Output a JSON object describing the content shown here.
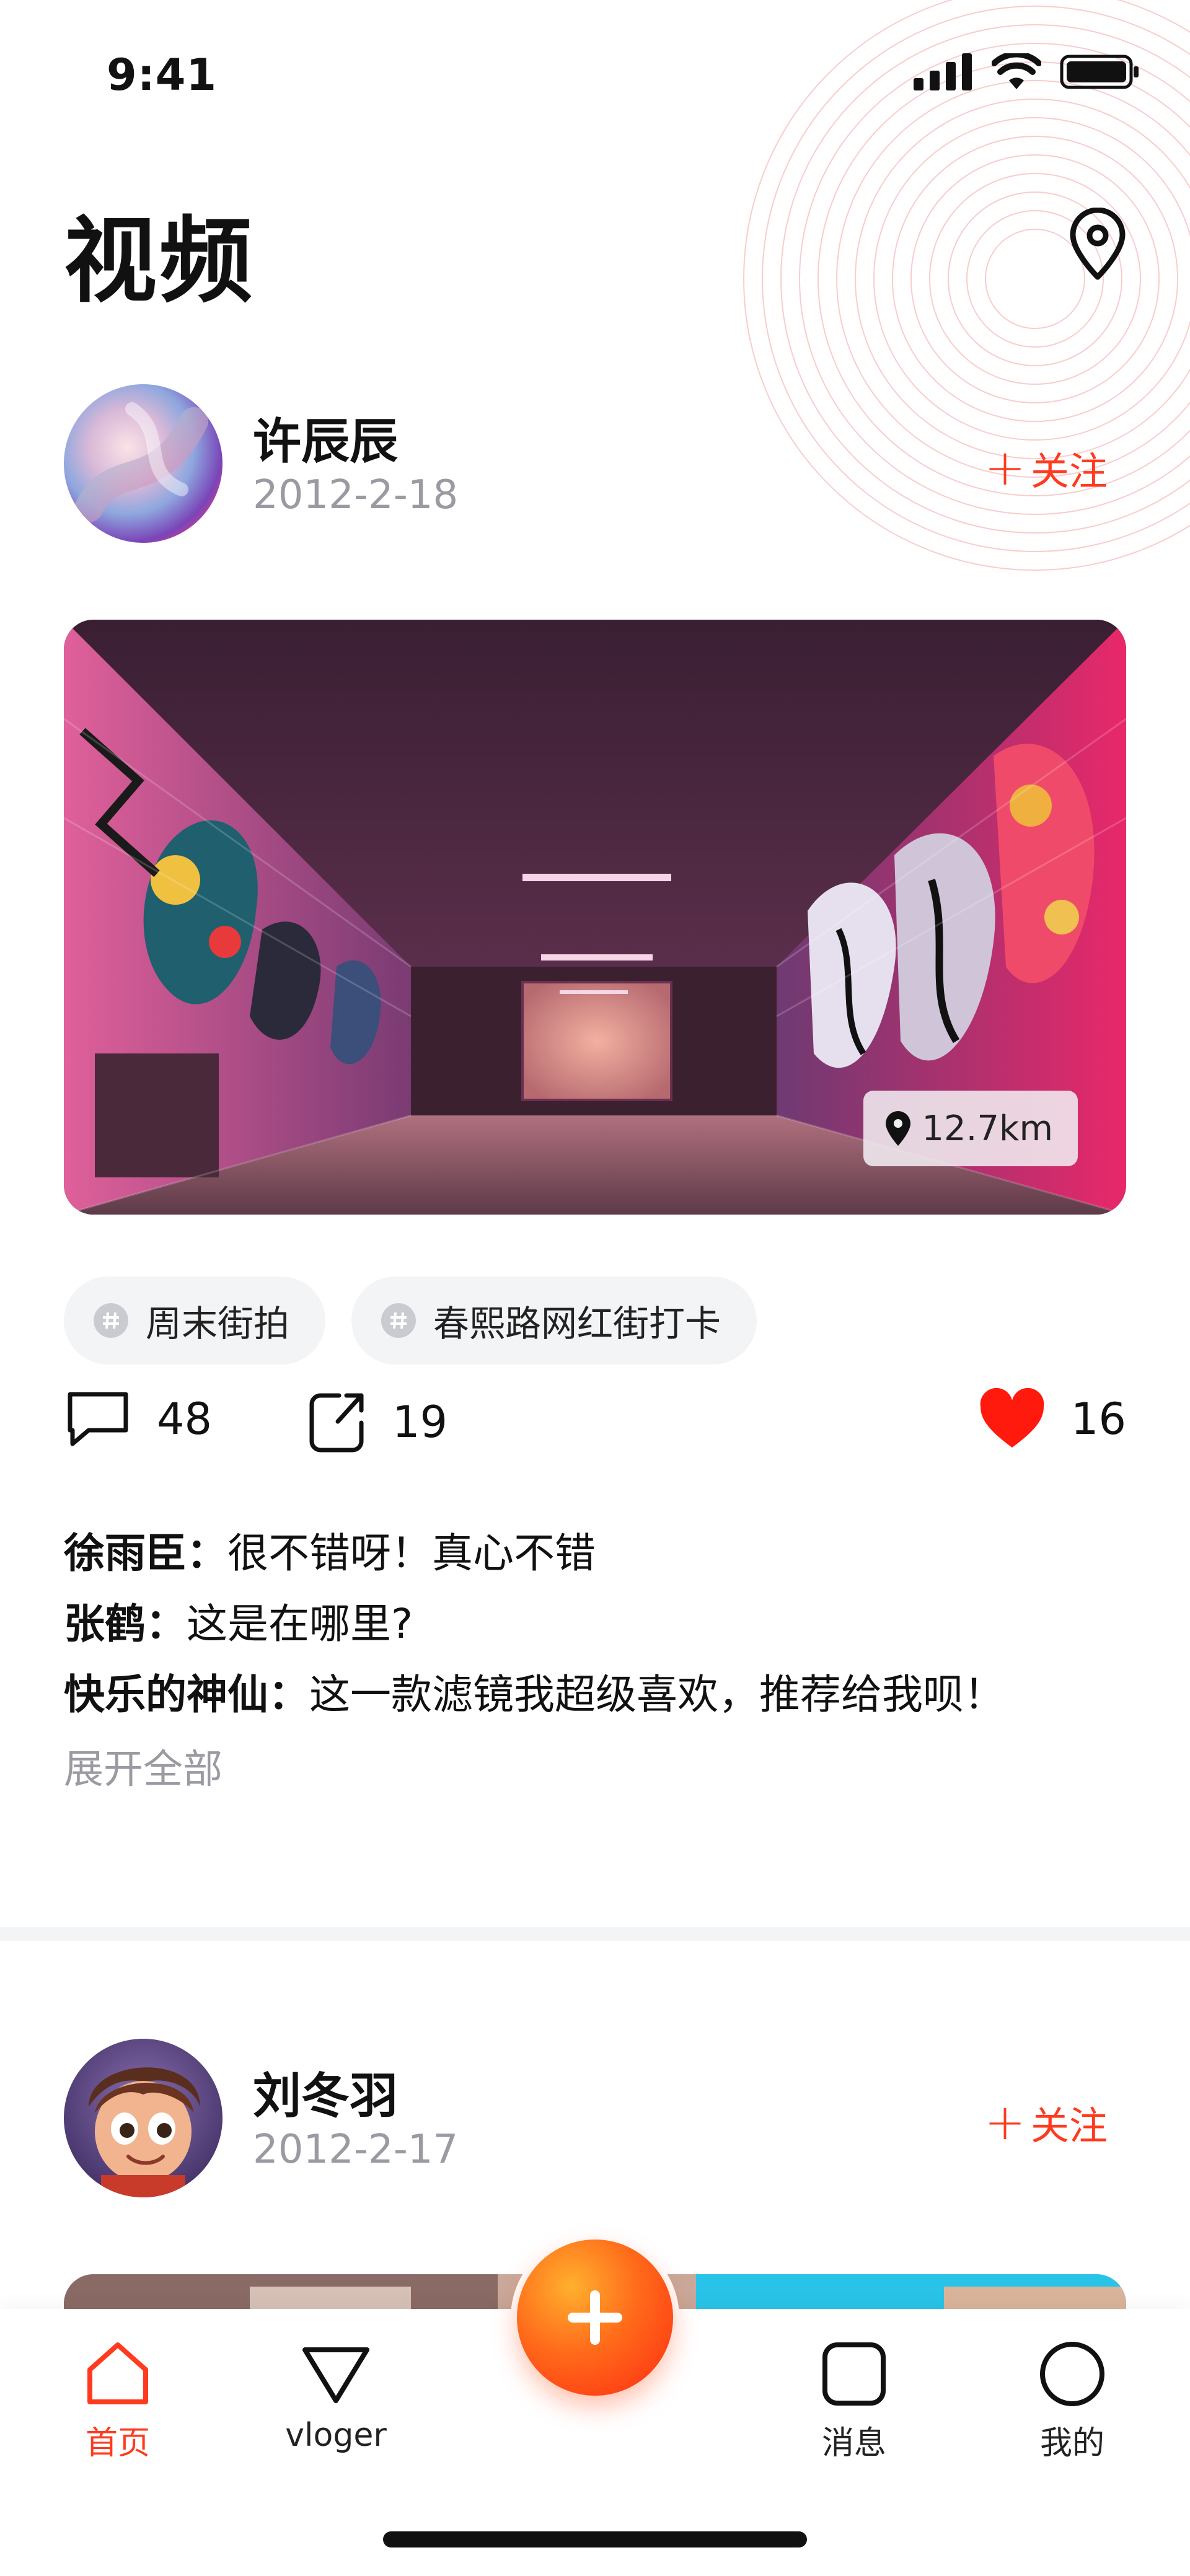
{
  "status": {
    "time": "9:41"
  },
  "header": {
    "title": "视频"
  },
  "posts": [
    {
      "author": "许辰辰",
      "date": "2012-2-18",
      "follow_label": "关注",
      "distance": "12.7km",
      "tags": [
        "周末街拍",
        "春熙路网红街打卡"
      ],
      "comments_count": "48",
      "shares_count": "19",
      "likes_count": "16",
      "comments": [
        {
          "name": "徐雨臣：",
          "text": "很不错呀！真心不错"
        },
        {
          "name": "张鹤：",
          "text": "这是在哪里?"
        },
        {
          "name": "快乐的神仙：",
          "text": "这一款滤镜我超级喜欢，推荐给我呗！"
        }
      ],
      "expand_label": "展开全部"
    },
    {
      "author": "刘冬羽",
      "date": "2012-2-17",
      "follow_label": "关注"
    }
  ],
  "nav": {
    "items": [
      {
        "label": "首页",
        "icon": "home-icon",
        "active": true
      },
      {
        "label": "vloger",
        "icon": "triangle-icon",
        "active": false
      },
      {
        "label": "消息",
        "icon": "square-icon",
        "active": false
      },
      {
        "label": "我的",
        "icon": "circle-icon",
        "active": false
      }
    ],
    "fab_icon": "plus-icon"
  },
  "colors": {
    "accent": "#ff3b1f",
    "like": "#ff1a0d",
    "muted": "#9a9aa3"
  }
}
